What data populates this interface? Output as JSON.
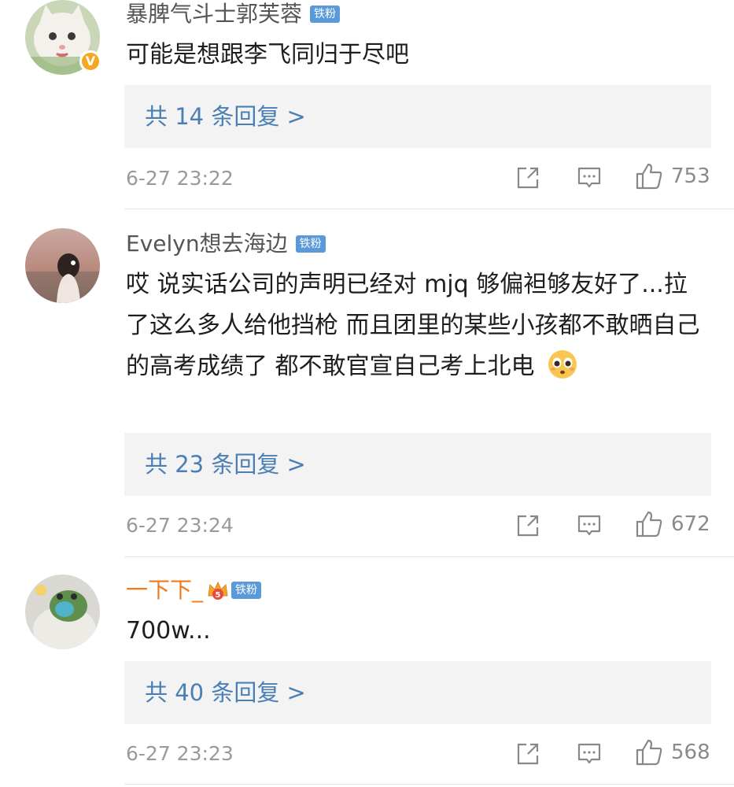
{
  "comments": [
    {
      "username": "暴脾气斗士郭芙蓉",
      "fan_badge": "铁粉",
      "verified_badge": "V",
      "text": "可能是想跟李飞同归于尽吧",
      "reply_label": "共 14 条回复 >",
      "time": "6-27 23:22",
      "likes": "753",
      "icons": [
        "share-icon",
        "comment-icon",
        "like-icon"
      ]
    },
    {
      "username": "Evelyn想去海边",
      "fan_badge": "铁粉",
      "text": "哎 说实话公司的声明已经对 mjq 够偏袒够友好了...拉了这么多人给他挡枪 而且团里的某些小孩都不敢晒自己的高考成绩了 都不敢官宣自己考上北电",
      "emoji": "pleading-face-emoji",
      "reply_label": "共 23 条回复 >",
      "time": "6-27 23:24",
      "likes": "672"
    },
    {
      "username": "一下下_",
      "fan_badge": "铁粉",
      "crown_level": "5",
      "text": "700w...",
      "reply_label": "共 40 条回复 >",
      "time": "6-27 23:23",
      "likes": "568"
    }
  ],
  "colors": {
    "reply_link": "#4a7fb5",
    "fan_badge": "#5a9ad9",
    "vip_name": "#f07c1f",
    "verified": "#f5a623"
  }
}
